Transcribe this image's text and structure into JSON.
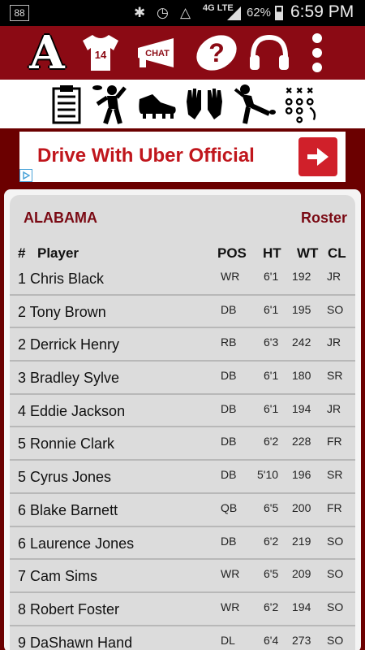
{
  "status_bar": {
    "notification_count": "88",
    "network": "4G LTE",
    "battery": "62%",
    "time": "6:59 PM"
  },
  "toolbar": {
    "logo_letter": "A",
    "jersey_number": "14",
    "chat_label": "CHAT",
    "help_glyph": "?"
  },
  "ad": {
    "title": "Drive With Uber Official"
  },
  "roster": {
    "team": "ALABAMA",
    "title": "Roster",
    "headers": {
      "num": "#",
      "player": "Player",
      "pos": "POS",
      "ht": "HT",
      "wt": "WT",
      "cl": "CL"
    },
    "players": [
      {
        "name": "1 Chris Black",
        "pos": "WR",
        "ht": "6'1",
        "wt": "192",
        "cl": "JR"
      },
      {
        "name": "2 Tony Brown",
        "pos": "DB",
        "ht": "6'1",
        "wt": "195",
        "cl": "SO"
      },
      {
        "name": "2 Derrick Henry",
        "pos": "RB",
        "ht": "6'3",
        "wt": "242",
        "cl": "JR"
      },
      {
        "name": "3 Bradley Sylve",
        "pos": "DB",
        "ht": "6'1",
        "wt": "180",
        "cl": "SR"
      },
      {
        "name": "4 Eddie Jackson",
        "pos": "DB",
        "ht": "6'1",
        "wt": "194",
        "cl": "JR"
      },
      {
        "name": "5 Ronnie Clark",
        "pos": "DB",
        "ht": "6'2",
        "wt": "228",
        "cl": "FR"
      },
      {
        "name": "5 Cyrus Jones",
        "pos": "DB",
        "ht": "5'10",
        "wt": "196",
        "cl": "SR"
      },
      {
        "name": "6 Blake Barnett",
        "pos": "QB",
        "ht": "6'5",
        "wt": "200",
        "cl": "FR"
      },
      {
        "name": "6 Laurence Jones",
        "pos": "DB",
        "ht": "6'2",
        "wt": "219",
        "cl": "SO"
      },
      {
        "name": "7 Cam Sims",
        "pos": "WR",
        "ht": "6'5",
        "wt": "209",
        "cl": "SO"
      },
      {
        "name": "8 Robert Foster",
        "pos": "WR",
        "ht": "6'2",
        "wt": "194",
        "cl": "SO"
      },
      {
        "name": "9 DaShawn Hand",
        "pos": "DL",
        "ht": "6'4",
        "wt": "273",
        "cl": "SO"
      }
    ]
  },
  "colors": {
    "brand_crimson": "#8b0a14",
    "team_text": "#7a0a14",
    "ad_red": "#c0161c"
  }
}
